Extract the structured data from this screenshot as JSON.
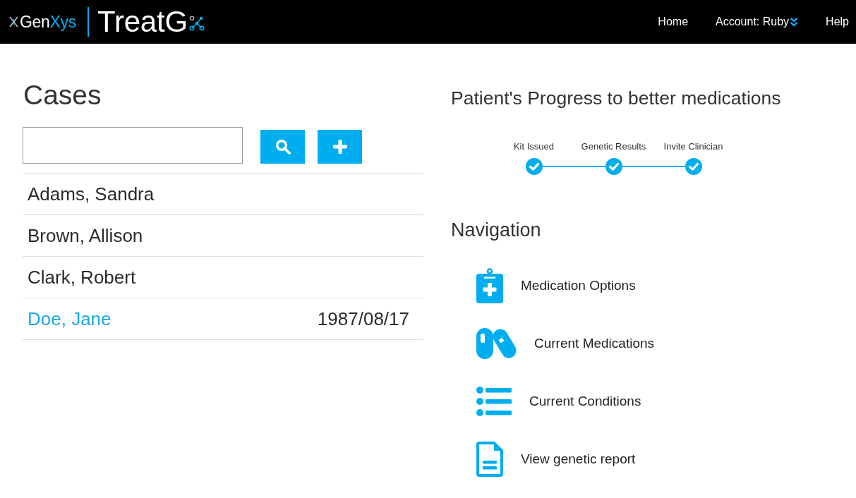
{
  "header": {
    "logo": {
      "brand_first": "Gen",
      "brand_second": "Xys",
      "product": "TreatG"
    },
    "nav": [
      {
        "label": "Home",
        "kind": "link"
      },
      {
        "label": "Account: Ruby",
        "kind": "menu"
      },
      {
        "label": "Help",
        "kind": "link"
      }
    ]
  },
  "cases": {
    "title": "Cases",
    "rows": [
      {
        "name": "Adams, Sandra",
        "selected": false
      },
      {
        "name": "Brown, Allison",
        "selected": false
      },
      {
        "name": "Clark, Robert",
        "selected": false
      },
      {
        "name": "Doe, Jane",
        "date": "1987/08/17",
        "selected": true
      }
    ]
  },
  "progress": {
    "title": "Patient's Progress to better medications",
    "steps": [
      {
        "label": "Kit Issued",
        "done": true
      },
      {
        "label": "Genetic Results",
        "done": true
      },
      {
        "label": "Invite Clinician",
        "done": true
      }
    ]
  },
  "navigation": {
    "title": "Navigation",
    "items": [
      {
        "label": "Medication Options",
        "kind": "clipboard"
      },
      {
        "label": "Current Medications",
        "kind": "pills"
      },
      {
        "label": "Current Conditions",
        "kind": "list"
      },
      {
        "label": "View genetic report",
        "kind": "document"
      }
    ]
  }
}
